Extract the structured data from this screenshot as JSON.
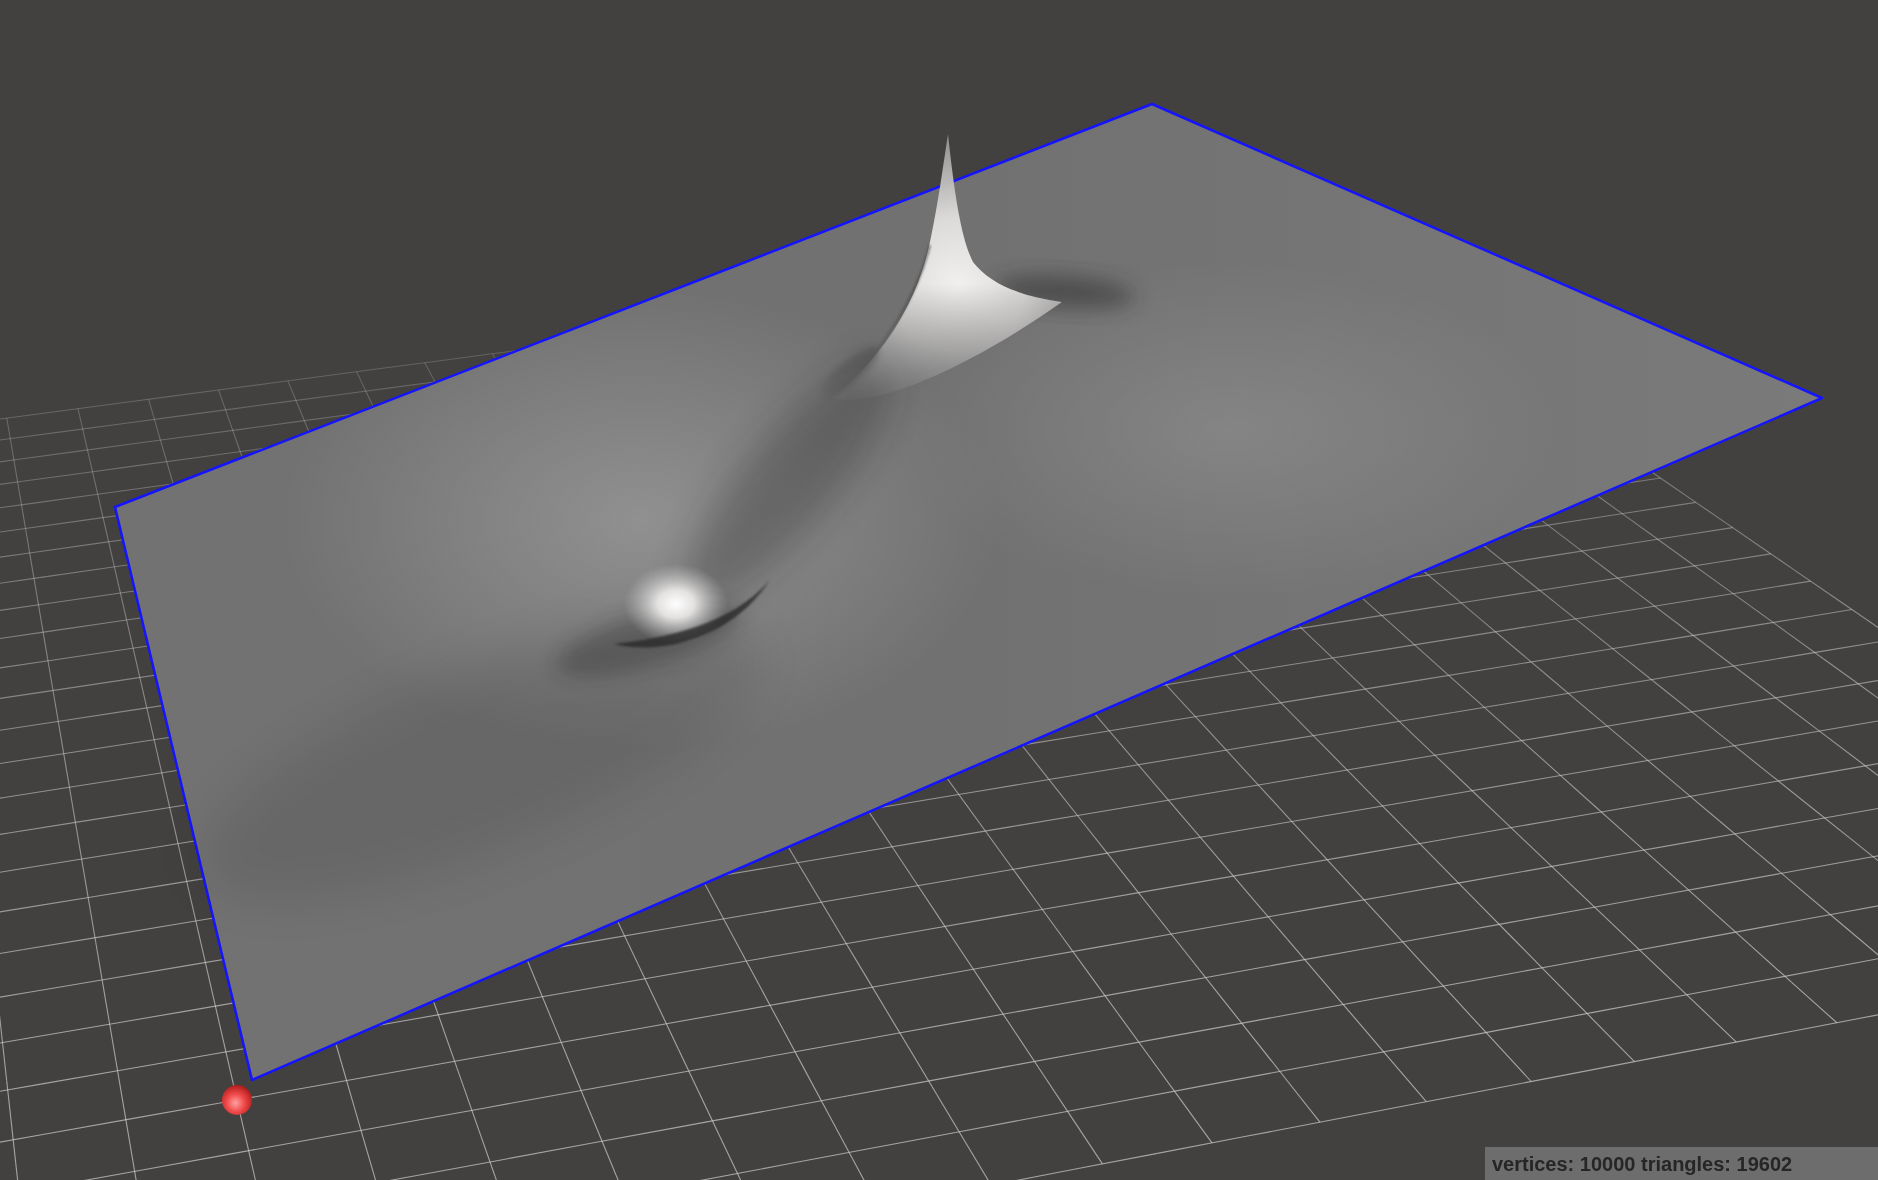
{
  "viewport": {
    "stats_text": "vertices: 10000 triangles: 19602"
  }
}
